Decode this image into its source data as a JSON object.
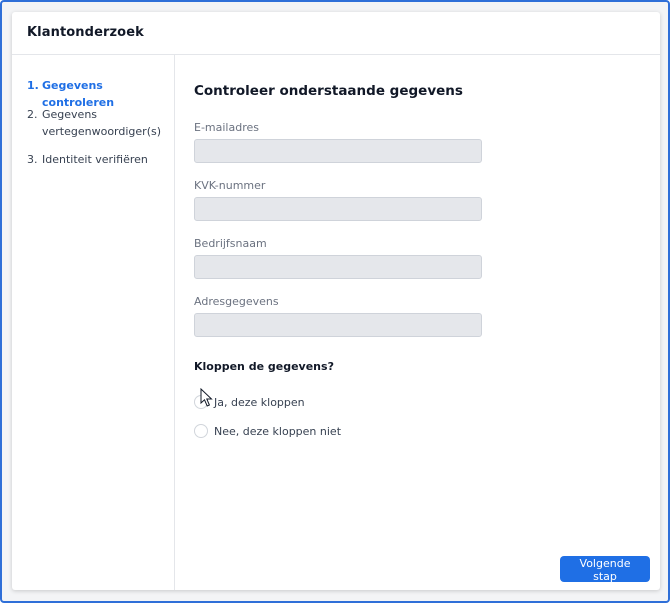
{
  "header": {
    "title": "Klantonderzoek"
  },
  "sidebar": {
    "steps": [
      {
        "number": "1.",
        "label": "Gegevens controleren",
        "active": true
      },
      {
        "number": "2.",
        "label": "Gegevens vertegenwoordiger(s)",
        "active": false
      },
      {
        "number": "3.",
        "label": "Identiteit verifiëren",
        "active": false
      }
    ]
  },
  "main": {
    "title": "Controleer onderstaande gegevens",
    "fields": [
      {
        "label": "E-mailadres",
        "value": ""
      },
      {
        "label": "KVK-nummer",
        "value": ""
      },
      {
        "label": "Bedrijfsnaam",
        "value": ""
      },
      {
        "label": "Adresgegevens",
        "value": ""
      }
    ],
    "question": "Kloppen de gegevens?",
    "options": [
      {
        "label": "Ja, deze kloppen",
        "selected": false
      },
      {
        "label": "Nee, deze kloppen niet",
        "selected": false
      }
    ]
  },
  "footer": {
    "next_label": "Volgende stap"
  },
  "colors": {
    "accent": "#1f6fe5",
    "frame": "#2f6fd8",
    "input_bg": "#e5e7eb"
  },
  "icons": {
    "pointer": "mouse-pointer-icon"
  }
}
